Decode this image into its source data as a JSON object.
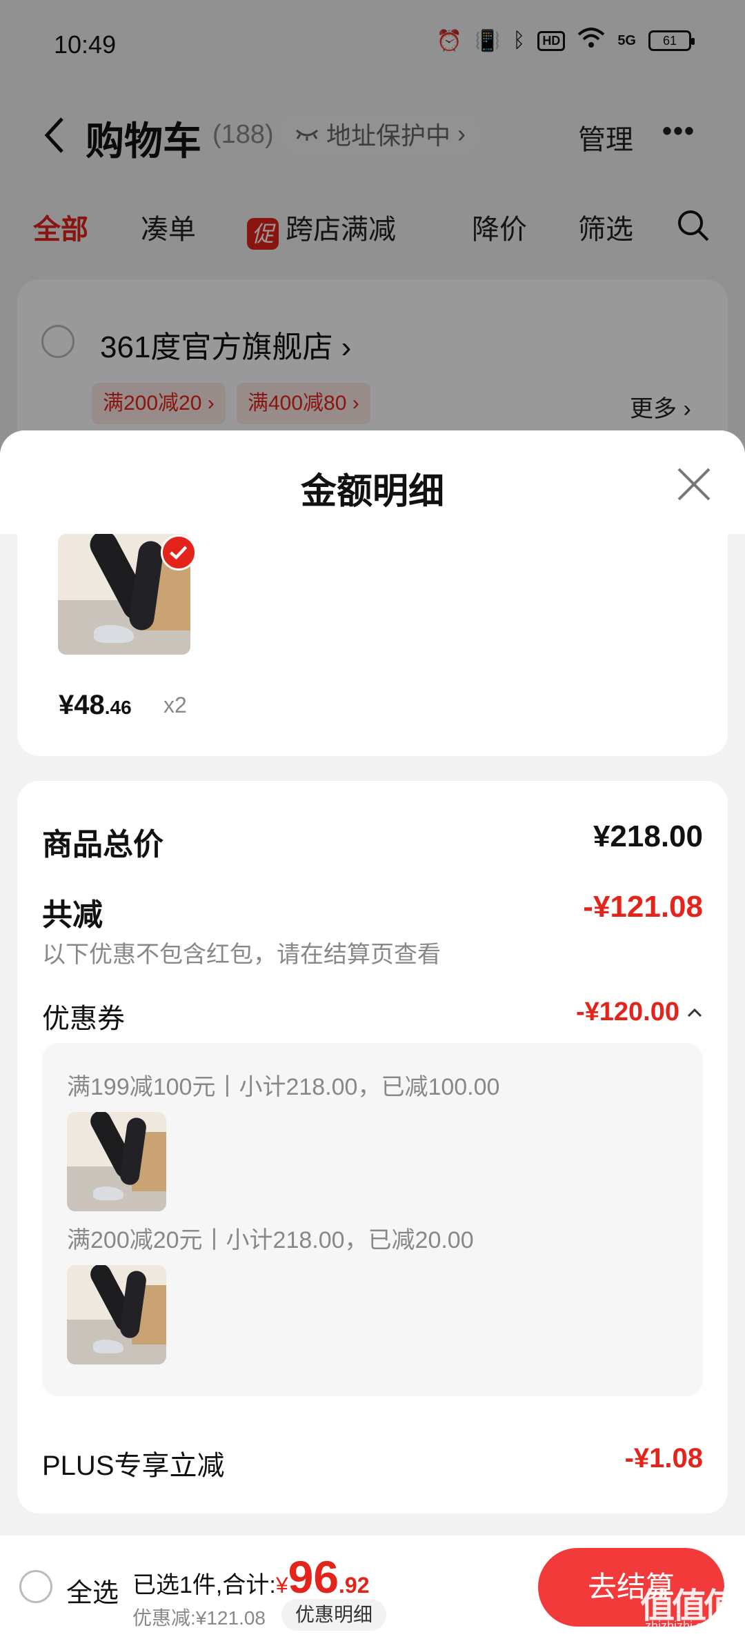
{
  "status_bar": {
    "time": "10:49",
    "network": "5G",
    "hd": "HD",
    "battery": "61"
  },
  "cart": {
    "title": "购物车",
    "count": "(188)",
    "address_protection": "地址保护中",
    "manage": "管理",
    "tabs": [
      "全部",
      "凑单",
      "跨店满减",
      "降价",
      "筛选"
    ],
    "promo_badge": "促",
    "store": {
      "name": "361度官方旗舰店",
      "coupons": [
        "满200减20",
        "满400减80"
      ],
      "more": "更多"
    }
  },
  "sheet": {
    "title": "金额明细",
    "item": {
      "price_int": "¥48",
      "price_dec": ".46",
      "qty": "x2"
    },
    "total_label": "商品总价",
    "total_value": "¥218.00",
    "reduction_label": "共减",
    "reduction_value": "-¥121.08",
    "reduction_note": "以下优惠不包含红包，请在结算页查看",
    "coupon_label": "优惠券",
    "coupon_value": "-¥120.00",
    "coupons": [
      {
        "text": "满199减100元丨小计218.00，已减100.00"
      },
      {
        "text": "满200减20元丨小计218.00，已减20.00"
      }
    ],
    "plus_label": "PLUS专享立减",
    "plus_value": "-¥1.08"
  },
  "bottom_bar": {
    "select_all": "全选",
    "selected_prefix": "已选1件,合计:",
    "currency": "¥",
    "total_int": "96",
    "total_dec": ".92",
    "discount": "优惠减:¥121.08",
    "detail_button": "优惠明细",
    "checkout": "去结算"
  },
  "watermark": {
    "logo": "值值值",
    "domain": "zhizhizhi.com"
  },
  "colors": {
    "accent_red": "#e4231b",
    "checkout_red": "#f23a3a",
    "overlay": "rgba(0,0,0,0.40)"
  }
}
